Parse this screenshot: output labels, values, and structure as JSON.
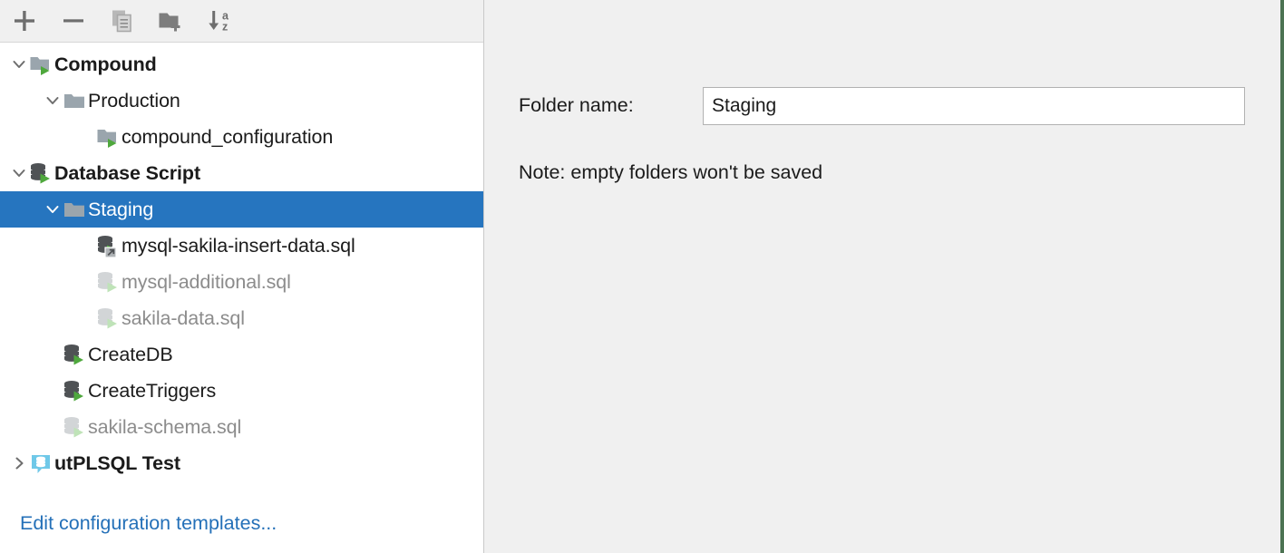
{
  "toolbar": {
    "buttons": [
      {
        "name": "add-configuration-button",
        "icon": "plus-icon",
        "tooltip": "Add New Configuration"
      },
      {
        "name": "remove-configuration-button",
        "icon": "minus-icon",
        "tooltip": "Remove Configuration"
      },
      {
        "name": "copy-configuration-button",
        "icon": "copy-icon",
        "tooltip": "Copy Configuration"
      },
      {
        "name": "new-folder-button",
        "icon": "new-folder-icon",
        "tooltip": "Create New Folder"
      },
      {
        "name": "sort-configurations-button",
        "icon": "sort-alphabetical-icon",
        "tooltip": "Sort Configurations"
      }
    ],
    "sort_icon_letters": {
      "top": "a",
      "bottom": "z"
    }
  },
  "tree": {
    "items": [
      {
        "label": "Compound",
        "indent": 0,
        "icon": "compound-run-folder-icon",
        "chevron": "down",
        "bold": true,
        "dimmed": false,
        "selected": false
      },
      {
        "label": "Production",
        "indent": 1,
        "icon": "folder-icon",
        "chevron": "down",
        "bold": false,
        "dimmed": false,
        "selected": false
      },
      {
        "label": "compound_configuration",
        "indent": 2,
        "icon": "compound-run-folder-icon",
        "chevron": "none",
        "bold": false,
        "dimmed": false,
        "selected": false
      },
      {
        "label": "Database Script",
        "indent": 0,
        "icon": "database-run-icon",
        "chevron": "down",
        "bold": true,
        "dimmed": false,
        "selected": false
      },
      {
        "label": "Staging",
        "indent": 1,
        "icon": "folder-icon",
        "chevron": "down",
        "bold": false,
        "dimmed": false,
        "selected": true
      },
      {
        "label": "mysql-sakila-insert-data.sql",
        "indent": 2,
        "icon": "database-shortcut-icon",
        "chevron": "none",
        "bold": false,
        "dimmed": false,
        "selected": false
      },
      {
        "label": "mysql-additional.sql",
        "indent": 2,
        "icon": "database-run-dim-icon",
        "chevron": "none",
        "bold": false,
        "dimmed": true,
        "selected": false
      },
      {
        "label": "sakila-data.sql",
        "indent": 2,
        "icon": "database-run-dim-icon",
        "chevron": "none",
        "bold": false,
        "dimmed": true,
        "selected": false
      },
      {
        "label": "CreateDB",
        "indent": 1,
        "icon": "database-run-icon",
        "chevron": "none",
        "bold": false,
        "dimmed": false,
        "selected": false
      },
      {
        "label": "CreateTriggers",
        "indent": 1,
        "icon": "database-run-icon",
        "chevron": "none",
        "bold": false,
        "dimmed": false,
        "selected": false
      },
      {
        "label": "sakila-schema.sql",
        "indent": 1,
        "icon": "database-run-dim-icon",
        "chevron": "none",
        "bold": false,
        "dimmed": true,
        "selected": false
      },
      {
        "label": "utPLSQL Test",
        "indent": 0,
        "icon": "utplsql-test-icon",
        "chevron": "right",
        "bold": true,
        "dimmed": false,
        "selected": false
      }
    ],
    "edit_templates_link": "Edit configuration templates..."
  },
  "details": {
    "folder_name_label": "Folder name:",
    "folder_name_value": "Staging",
    "folder_name_placeholder": "",
    "note": "Note: empty folders won't be saved"
  },
  "colors": {
    "selection_blue": "#2675bf",
    "link_blue": "#2470b8",
    "panel_grey": "#f0f0f0",
    "icon_grey": "#9aa5ad",
    "run_green": "#4fa83d",
    "db_dark": "#4f5255",
    "utplsql_blue": "#6fc8e8",
    "right_border_green": "#4c7352"
  }
}
